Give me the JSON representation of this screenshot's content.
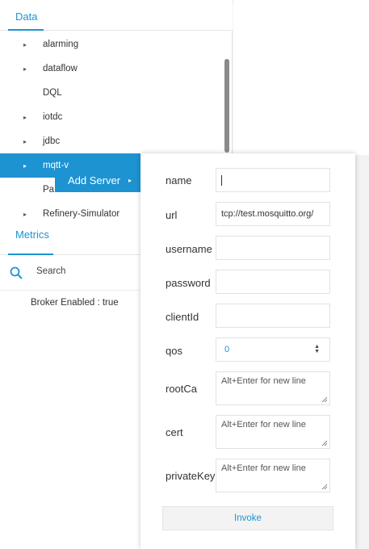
{
  "data_tab": {
    "label": "Data"
  },
  "tree": {
    "items": [
      {
        "label": "alarming",
        "arrow": "▸"
      },
      {
        "label": "dataflow",
        "arrow": "▸"
      },
      {
        "label": "DQL",
        "arrow": ""
      },
      {
        "label": "iotdc",
        "arrow": "▸"
      },
      {
        "label": "jdbc",
        "arrow": "▸"
      },
      {
        "label": "mqtt-v",
        "arrow": "▸"
      },
      {
        "label": "Pa",
        "arrow": ""
      },
      {
        "label": "Refinery-Simulator",
        "arrow": "▸"
      }
    ]
  },
  "context_menu": {
    "add_server": "Add Server",
    "arrow": "▸"
  },
  "metrics_tab": {
    "label": "Metrics"
  },
  "search": {
    "placeholder": "Search"
  },
  "broker_status": "Broker Enabled : true",
  "form": {
    "name_label": "name",
    "name_value": "",
    "url_label": "url",
    "url_value": "tcp://test.mosquitto.org/",
    "username_label": "username",
    "username_value": "",
    "password_label": "password",
    "password_value": "",
    "clientid_label": "clientId",
    "clientid_value": "",
    "qos_label": "qos",
    "qos_value": "0",
    "rootca_label": "rootCa",
    "rootca_placeholder": "Alt+Enter for new line",
    "cert_label": "cert",
    "cert_placeholder": "Alt+Enter for new line",
    "privatekey_label": "privateKey",
    "privatekey_placeholder": "Alt+Enter for new line",
    "invoke_label": "Invoke"
  },
  "colors": {
    "accent": "#1d93d2"
  }
}
